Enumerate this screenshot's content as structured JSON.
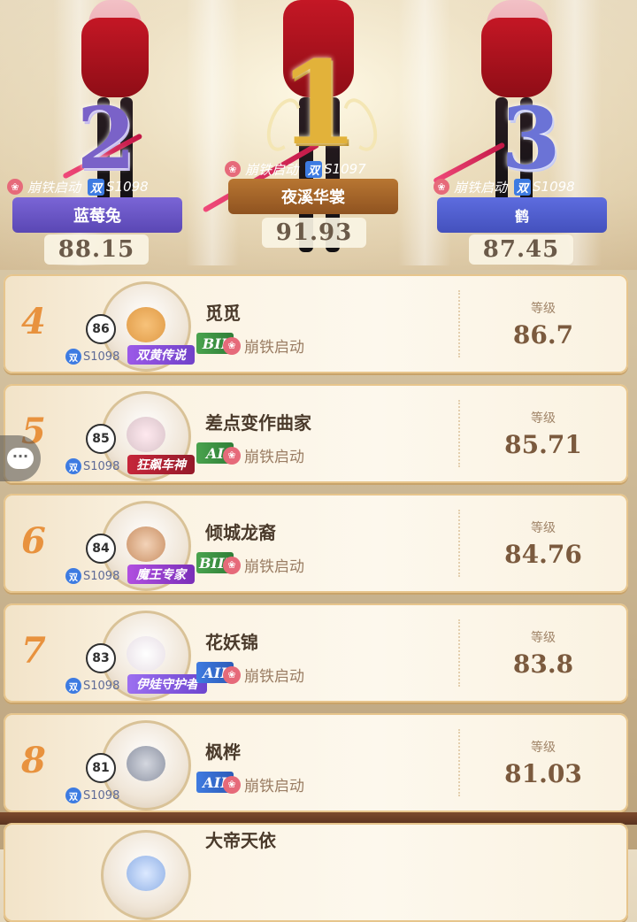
{
  "top3": [
    {
      "rank": "2",
      "guild": "崩铁启动",
      "server_chip": "双",
      "server": "S1098",
      "name": "蓝莓兔",
      "score": "88.15"
    },
    {
      "rank": "1",
      "guild": "崩铁启动",
      "server_chip": "双",
      "server": "S1097",
      "name": "夜溪华裳",
      "score": "91.93"
    },
    {
      "rank": "3",
      "guild": "崩铁启动",
      "server_chip": "双",
      "server": "S1098",
      "name": "鹤",
      "score": "87.45"
    }
  ],
  "list": [
    {
      "rank": "4",
      "level_badge": "86",
      "server_chip": "双",
      "server": "S1098",
      "title": "双黄传说",
      "tier": "BII",
      "name": "觅觅",
      "guild": "崩铁启动",
      "level_label": "等级",
      "level_value": "86.7"
    },
    {
      "rank": "5",
      "level_badge": "85",
      "server_chip": "双",
      "server": "S1098",
      "title": "狂飙车神",
      "tier": "AI",
      "name": "差点变作曲家",
      "guild": "崩铁启动",
      "level_label": "等级",
      "level_value": "85.71"
    },
    {
      "rank": "6",
      "level_badge": "84",
      "server_chip": "双",
      "server": "S1098",
      "title": "魔王专家",
      "tier": "BIII",
      "name": "倾城龙裔",
      "guild": "崩铁启动",
      "level_label": "等级",
      "level_value": "84.76"
    },
    {
      "rank": "7",
      "level_badge": "83",
      "server_chip": "双",
      "server": "S1098",
      "title": "伊娃守护者",
      "tier": "AII",
      "name": "花妖锦",
      "guild": "崩铁启动",
      "level_label": "等级",
      "level_value": "83.8"
    },
    {
      "rank": "8",
      "level_badge": "81",
      "server_chip": "双",
      "server": "S1098",
      "title": "",
      "tier": "AII",
      "name": "枫桦",
      "guild": "崩铁启动",
      "level_label": "等级",
      "level_value": "81.03"
    },
    {
      "rank": "",
      "level_badge": "",
      "server_chip": "",
      "server": "",
      "title": "",
      "tier": "",
      "name": "大帝天依",
      "guild": "",
      "level_label": "",
      "level_value": ""
    }
  ],
  "chat_icon": "chat-bubble-icon",
  "rose_icon": "rose-icon",
  "colors": {
    "accent_gold": "#e2b23a",
    "rank_orange": "#e8923e",
    "server_blue": "#3d7be2",
    "plate_purple": "#6a55c9",
    "plate_gold": "#a8672a",
    "plate_blue": "#4f5ed0"
  }
}
